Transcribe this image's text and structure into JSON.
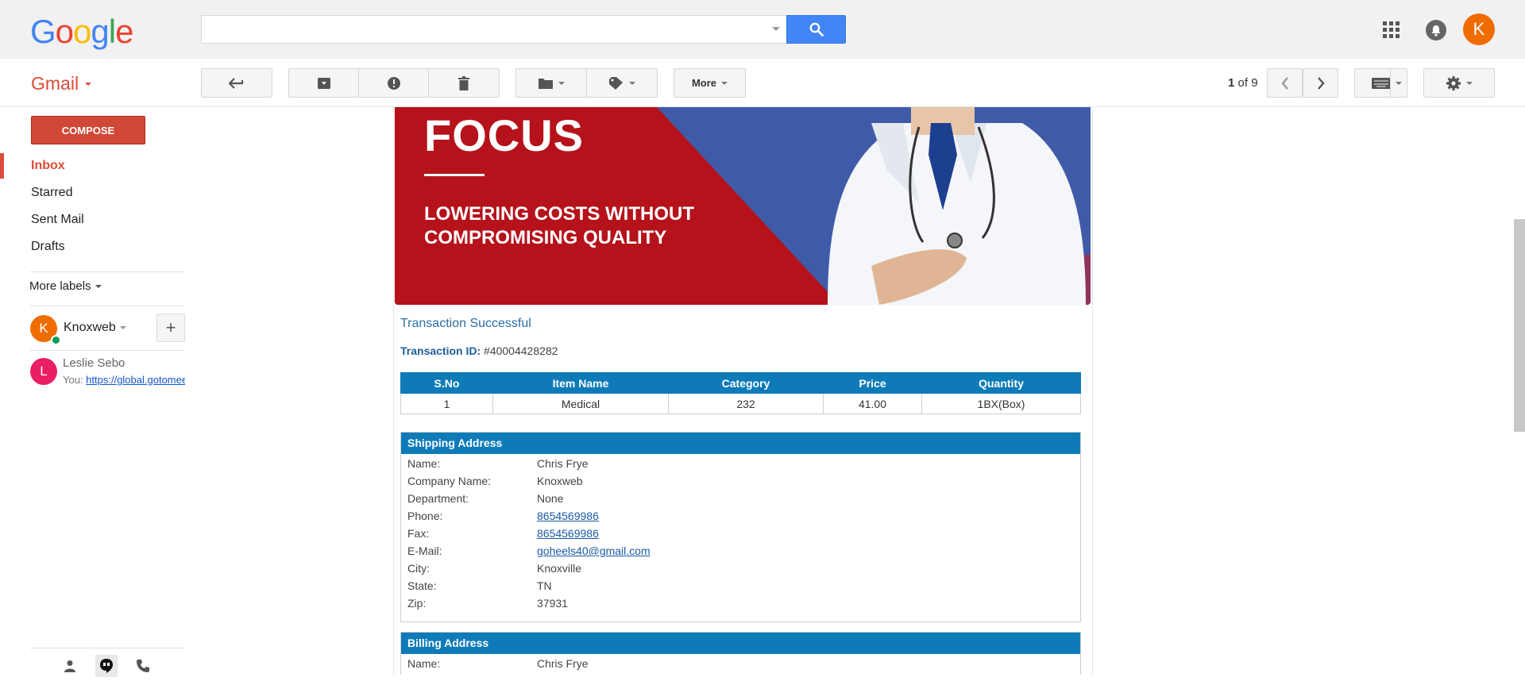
{
  "header": {
    "logo_letters": [
      "G",
      "o",
      "o",
      "g",
      "l",
      "e"
    ],
    "search_placeholder": "",
    "avatar_letter": "K"
  },
  "toolbar": {
    "app_label": "Gmail",
    "more_label": "More",
    "pager_current": "1",
    "pager_sep": " of ",
    "pager_total": "9"
  },
  "sidebar": {
    "compose_label": "COMPOSE",
    "items": [
      {
        "label": "Inbox",
        "active": true
      },
      {
        "label": "Starred"
      },
      {
        "label": "Sent Mail"
      },
      {
        "label": "Drafts"
      }
    ],
    "more_labels": "More labels",
    "hangouts_user": {
      "letter": "K",
      "name": "Knoxweb"
    },
    "chat": {
      "letter": "L",
      "name": "Leslie Sebo",
      "prefix": "You: ",
      "link": "https://global.gotomeeting.com"
    }
  },
  "email": {
    "banner_title": "FOCUS",
    "banner_subtitle_1": "LOWERING COSTS WITHOUT",
    "banner_subtitle_2": "COMPROMISING QUALITY",
    "status": "Transaction Successful",
    "txn_label": "Transaction ID:",
    "txn_value": " #40004428282",
    "items_table": {
      "headers": [
        "S.No",
        "Item Name",
        "Category",
        "Price",
        "Quantity"
      ],
      "rows": [
        [
          "1",
          "Medical",
          "232",
          "41.00",
          "1BX(Box)"
        ]
      ]
    },
    "shipping": {
      "title": "Shipping Address",
      "fields": [
        {
          "k": "Name:",
          "v": "Chris Frye"
        },
        {
          "k": "Company Name:",
          "v": "Knoxweb"
        },
        {
          "k": "Department:",
          "v": "None"
        },
        {
          "k": "Phone:",
          "v": "8654569986",
          "link": true
        },
        {
          "k": "Fax:",
          "v": "8654569986",
          "link": true
        },
        {
          "k": "E-Mail:",
          "v": "goheels40@gmail.com",
          "link": true
        },
        {
          "k": "City:",
          "v": "Knoxville"
        },
        {
          "k": "State:",
          "v": "TN"
        },
        {
          "k": "Zip:",
          "v": "37931"
        }
      ]
    },
    "billing": {
      "title": "Billing Address",
      "fields": [
        {
          "k": "Name:",
          "v": "Chris Frye"
        }
      ]
    }
  },
  "colors": {
    "gmail_red": "#dd4b39",
    "search_blue": "#4285f4",
    "table_blue": "#0e7bb8",
    "avatar_orange": "#ef6c00",
    "banner_red": "#b5121b",
    "banner_blue": "#3f5ba8"
  }
}
